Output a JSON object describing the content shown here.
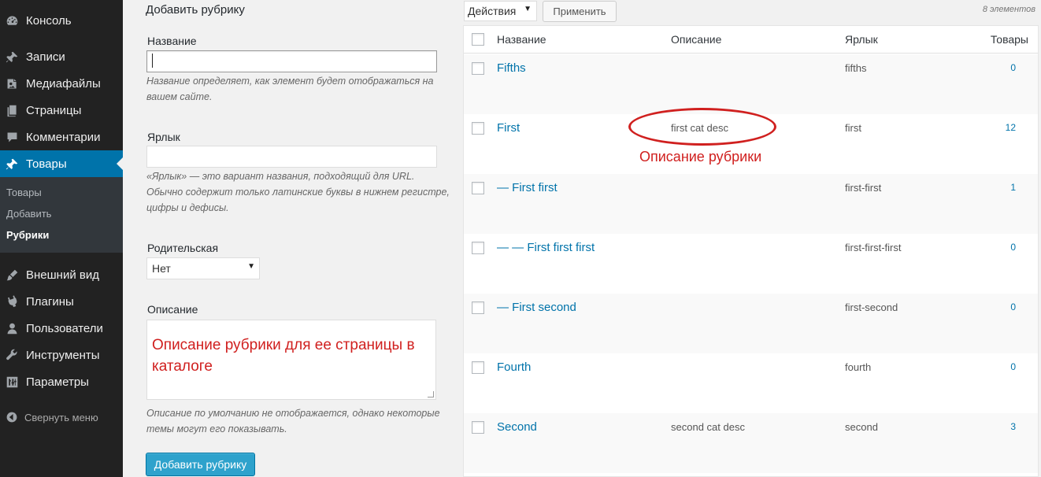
{
  "sidebar": {
    "menu": [
      {
        "label": "Консоль",
        "icon": "dashboard-icon"
      },
      {
        "label": "Записи",
        "icon": "pin-icon"
      },
      {
        "label": "Медиафайлы",
        "icon": "media-icon"
      },
      {
        "label": "Страницы",
        "icon": "pages-icon"
      },
      {
        "label": "Комментарии",
        "icon": "comment-icon"
      },
      {
        "label": "Товары",
        "icon": "pin-icon"
      },
      {
        "label": "Внешний вид",
        "icon": "brush-icon"
      },
      {
        "label": "Плагины",
        "icon": "plugin-icon"
      },
      {
        "label": "Пользователи",
        "icon": "user-icon"
      },
      {
        "label": "Инструменты",
        "icon": "wrench-icon"
      },
      {
        "label": "Параметры",
        "icon": "settings-icon"
      }
    ],
    "submenu": [
      {
        "label": "Товары"
      },
      {
        "label": "Добавить"
      },
      {
        "label": "Рубрики"
      }
    ],
    "collapse_label": "Свернуть меню",
    "accent": "#0073aa",
    "background": "#222222"
  },
  "form": {
    "title": "Добавить рубрику",
    "name_label": "Название",
    "name_value": "",
    "name_hint": "Название определяет, как элемент будет отображаться на вашем сайте.",
    "slug_label": "Ярлык",
    "slug_value": "",
    "slug_hint": "«Ярлык» — это вариант названия, подходящий для URL. Обычно содержит только латинские буквы в нижнем регистре, цифры и дефисы.",
    "parent_label": "Родительская",
    "parent_selected": "Нет",
    "description_label": "Описание",
    "description_annotation": "Описание рубрики для ее страницы в каталоге",
    "description_hint": "Описание по умолчанию не отображается, однако некоторые темы могут его показывать.",
    "submit_label": "Добавить рубрику"
  },
  "table": {
    "bulk_action_selected": "Действия",
    "apply_label": "Применить",
    "items_count": "8 элементов",
    "columns": [
      "Название",
      "Описание",
      "Ярлык",
      "Товары"
    ],
    "rows": [
      {
        "name": "Fifths",
        "description": "",
        "slug": "fifths",
        "count": "0"
      },
      {
        "name": "First",
        "description": "first cat desc",
        "slug": "first",
        "count": "12"
      },
      {
        "name": "— First first",
        "description": "",
        "slug": "first-first",
        "count": "1"
      },
      {
        "name": "— — First first first",
        "description": "",
        "slug": "first-first-first",
        "count": "0"
      },
      {
        "name": "— First second",
        "description": "",
        "slug": "first-second",
        "count": "0"
      },
      {
        "name": "Fourth",
        "description": "",
        "slug": "fourth",
        "count": "0"
      },
      {
        "name": "Second",
        "description": "second cat desc",
        "slug": "second",
        "count": "3"
      }
    ]
  },
  "annotation": {
    "label": "Описание рубрики",
    "color": "#d0201f"
  }
}
